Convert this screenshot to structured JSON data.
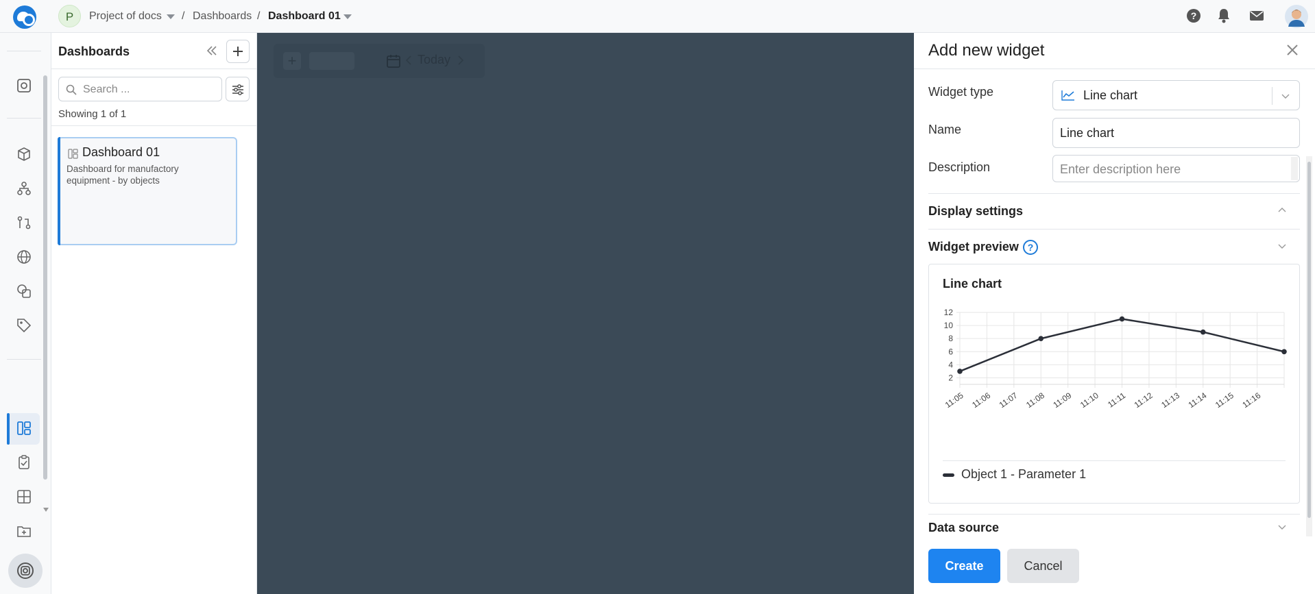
{
  "topbar": {
    "project_initial": "P",
    "project_name": "Project of docs",
    "separator": "/",
    "crumb_dashboards": "Dashboards",
    "crumb_current": "Dashboard 01"
  },
  "dashboards_panel": {
    "title": "Dashboards",
    "search_placeholder": "Search ...",
    "showing": "Showing 1 of 1",
    "items": [
      {
        "title": "Dashboard 01",
        "description": "Dashboard for manufactory equipment - by objects"
      }
    ]
  },
  "canvas": {
    "today_label": "Today"
  },
  "widget_panel": {
    "title": "Add new widget",
    "widget_type_label": "Widget type",
    "widget_type_value": "Line chart",
    "name_label": "Name",
    "name_value": "Line chart",
    "description_label": "Description",
    "description_placeholder": "Enter description here",
    "display_settings": "Display settings",
    "widget_preview": "Widget preview",
    "help_glyph": "?",
    "data_source": "Data source",
    "create_label": "Create",
    "cancel_label": "Cancel",
    "accent_color": "#1e84f0"
  },
  "chart_data": {
    "type": "line",
    "title": "Line chart",
    "x": [
      "11:05",
      "11:06",
      "11:07",
      "11:08",
      "11:09",
      "11:10",
      "11:11",
      "11:12",
      "11:13",
      "11:14",
      "11:15",
      "11:16"
    ],
    "yticks": [
      2,
      4,
      6,
      8,
      10,
      12
    ],
    "ylim": [
      1,
      12
    ],
    "grid": true,
    "legend_position": "bottom",
    "series": [
      {
        "name": "Object 1 - Parameter 1",
        "color": "#2b2f38",
        "points": [
          {
            "t": 0.0,
            "y": 3
          },
          {
            "t": 3.0,
            "y": 8
          },
          {
            "t": 6.0,
            "y": 11
          },
          {
            "t": 9.0,
            "y": 9
          },
          {
            "t": 12.0,
            "y": 6
          }
        ]
      }
    ]
  }
}
